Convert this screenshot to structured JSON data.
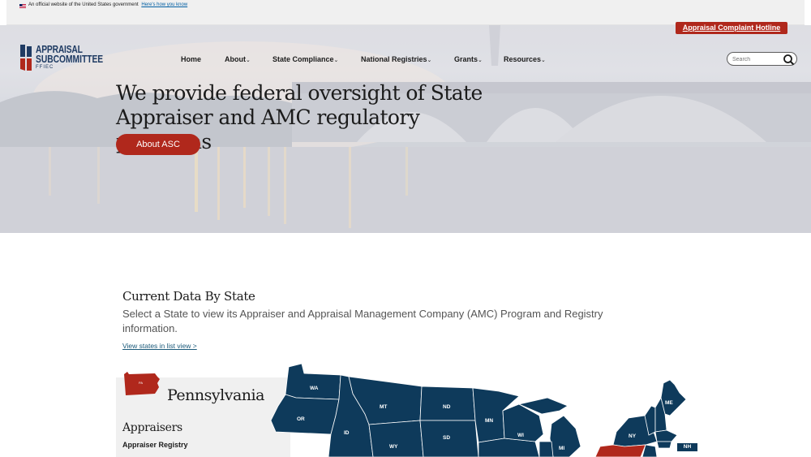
{
  "gov_banner": {
    "text": "An official website of the United States government",
    "link": "Here's how you know"
  },
  "hotline": "Appraisal Complaint Hotline",
  "logo": {
    "line1": "APPRAISAL",
    "line2": "SUBCOMMITTEE",
    "line3": "FFIEC"
  },
  "nav": [
    {
      "label": "Home"
    },
    {
      "label": "About",
      "chevron": "⌄"
    },
    {
      "label": "State Compliance",
      "chevron": "⌄"
    },
    {
      "label": "National Registries",
      "chevron": "⌄"
    },
    {
      "label": "Grants",
      "chevron": "⌄"
    },
    {
      "label": "Resources",
      "chevron": "⌄"
    }
  ],
  "search": {
    "placeholder": "Search",
    "icon": "search-icon"
  },
  "hero": {
    "title": "We provide federal oversight of State Appraiser and AMC regulatory programs",
    "button": "About ASC"
  },
  "state_data": {
    "title": "Current Data By State",
    "description": "Select a State to view its Appraiser and Appraisal Management Company (AMC) Program and Registry information.",
    "list_link": "View states in list view >",
    "selected_state": "Pennsylvania",
    "selected_state_abbrev": "PA",
    "appraisers_heading": "Appraisers",
    "appraiser_registry": "Appraiser Registry"
  },
  "map_labels": [
    "WA",
    "OR",
    "ID",
    "MT",
    "WY",
    "ND",
    "SD",
    "MN",
    "WI",
    "MI",
    "NY",
    "ME",
    "NH"
  ],
  "colors": {
    "accent": "#b0281c",
    "map_state": "#0e3a5b",
    "brand": "#1f3b63"
  }
}
